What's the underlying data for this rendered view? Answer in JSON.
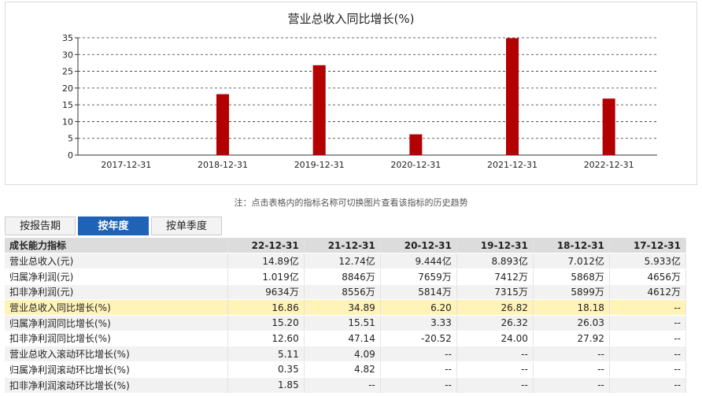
{
  "chart_data": {
    "type": "bar",
    "title": "营业总收入同比增长(%)",
    "categories": [
      "2017-12-31",
      "2018-12-31",
      "2019-12-31",
      "2020-12-31",
      "2021-12-31",
      "2022-12-31"
    ],
    "values": [
      null,
      18.18,
      26.82,
      6.2,
      34.89,
      16.86
    ],
    "yticks": [
      0,
      5,
      10,
      15,
      20,
      25,
      30,
      35
    ],
    "ylim": [
      0,
      35
    ],
    "grid": "dashed horizontal",
    "bar_color": "#b30000"
  },
  "note": "注：点击表格内的指标名称可切换图片查看该指标的历史趋势",
  "tabs": [
    {
      "label": "按报告期"
    },
    {
      "label": "按年度"
    },
    {
      "label": "按单季度"
    }
  ],
  "table": {
    "header": [
      "成长能力指标",
      "22-12-31",
      "21-12-31",
      "20-12-31",
      "19-12-31",
      "18-12-31",
      "17-12-31"
    ],
    "rows": [
      {
        "cells": [
          "营业总收入(元)",
          "14.89亿",
          "12.74亿",
          "9.444亿",
          "8.893亿",
          "7.012亿",
          "5.933亿"
        ]
      },
      {
        "cells": [
          "归属净利润(元)",
          "1.019亿",
          "8846万",
          "7659万",
          "7412万",
          "5868万",
          "4656万"
        ]
      },
      {
        "cells": [
          "扣非净利润(元)",
          "9634万",
          "8556万",
          "5814万",
          "7315万",
          "5899万",
          "4612万"
        ]
      },
      {
        "cells": [
          "营业总收入同比增长(%)",
          "16.86",
          "34.89",
          "6.20",
          "26.82",
          "18.18",
          "--"
        ]
      },
      {
        "cells": [
          "归属净利润同比增长(%)",
          "15.20",
          "15.51",
          "3.33",
          "26.32",
          "26.03",
          "--"
        ]
      },
      {
        "cells": [
          "扣非净利润同比增长(%)",
          "12.60",
          "47.14",
          "-20.52",
          "24.00",
          "27.92",
          "--"
        ]
      },
      {
        "cells": [
          "营业总收入滚动环比增长(%)",
          "5.11",
          "4.09",
          "--",
          "--",
          "--",
          "--"
        ]
      },
      {
        "cells": [
          "归属净利润滚动环比增长(%)",
          "0.35",
          "4.82",
          "--",
          "--",
          "--",
          "--"
        ]
      },
      {
        "cells": [
          "扣非净利润滚动环比增长(%)",
          "1.85",
          "--",
          "--",
          "--",
          "--",
          "--"
        ]
      }
    ]
  }
}
